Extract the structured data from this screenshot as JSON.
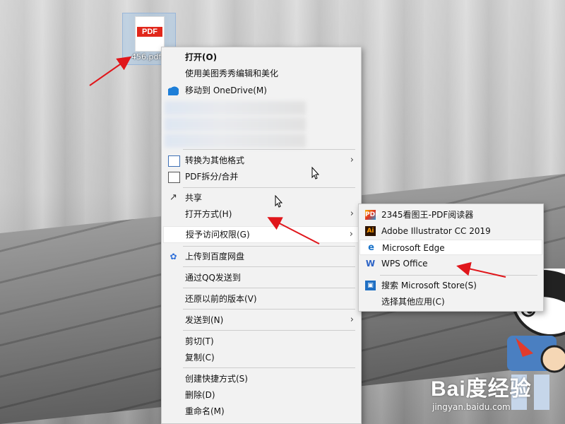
{
  "desktop": {
    "file_icon": {
      "badge": "PDF",
      "label": "456.pdf"
    }
  },
  "context_menu": {
    "items": [
      {
        "label": "打开(O)",
        "bold": true
      },
      {
        "label": "使用美图秀秀编辑和美化"
      },
      {
        "label": "移动到 OneDrive(M)",
        "icon": "onedrive-icon"
      },
      {
        "label": "转换为其他格式",
        "icon": "convert-icon",
        "submenu": true
      },
      {
        "label": "PDF拆分/合并",
        "icon": "pdf-split-icon"
      },
      {
        "label": "共享",
        "icon": "share-icon"
      },
      {
        "label": "打开方式(H)",
        "submenu": true
      },
      {
        "label": "授予访问权限(G)",
        "submenu": true,
        "highlighted": true
      },
      {
        "label": "上传到百度网盘",
        "icon": "baidu-netdisk-icon"
      },
      {
        "label": "通过QQ发送到"
      },
      {
        "label": "还原以前的版本(V)"
      },
      {
        "label": "发送到(N)",
        "submenu": true
      },
      {
        "label": "剪切(T)"
      },
      {
        "label": "复制(C)"
      },
      {
        "label": "创建快捷方式(S)"
      },
      {
        "label": "删除(D)"
      },
      {
        "label": "重命名(M)"
      }
    ],
    "submenu_arrow": "›"
  },
  "open_with_menu": {
    "items": [
      {
        "label": "2345看图王-PDF阅读器",
        "icon": "2345-viewer-icon",
        "glyph": "PDF"
      },
      {
        "label": "Adobe Illustrator CC 2019",
        "icon": "illustrator-icon",
        "glyph": "Ai"
      },
      {
        "label": "Microsoft Edge",
        "icon": "edge-icon",
        "glyph": "e",
        "highlighted": true
      },
      {
        "label": "WPS Office",
        "icon": "wps-icon",
        "glyph": "W"
      },
      {
        "label": "搜索 Microsoft Store(S)",
        "icon": "store-icon",
        "glyph": "▣"
      },
      {
        "label": "选择其他应用(C)"
      }
    ]
  },
  "watermark": {
    "brand": "Bai度经验",
    "url": "jingyan.baidu.com"
  },
  "colors": {
    "menu_bg": "#f2f2f2",
    "highlight": "#ffffff",
    "annotation_red": "#e0161b",
    "pdf_red": "#e1271b"
  }
}
